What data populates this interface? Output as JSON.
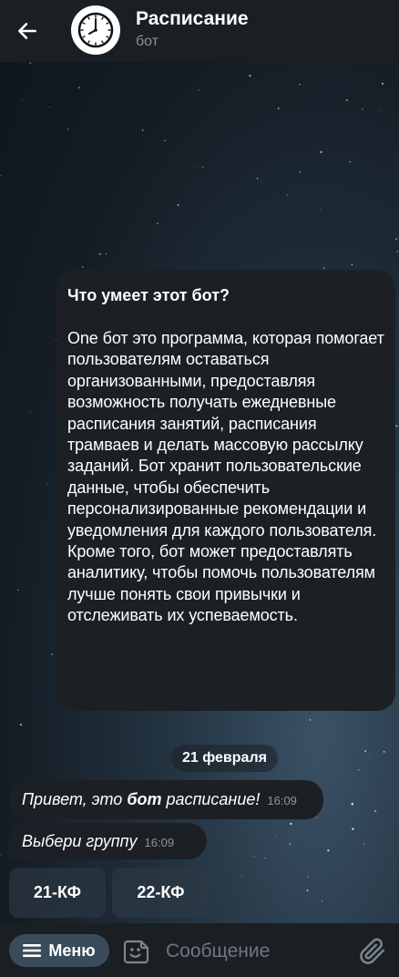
{
  "header": {
    "title": "Расписание",
    "subtitle": "бот",
    "back_icon": "arrow-left-icon",
    "avatar_icon": "clock-icon"
  },
  "intro": {
    "title": "Что умеет этот бот?",
    "text": "One бот это программа, которая помогает пользователям оставаться организованными, предоставляя возможность получать ежедневные расписания занятий, расписания трамваев и делать массовую рассылку заданий. Бот хранит пользовательские данные, чтобы обеспечить персонализированные рекомендации и уведомления для каждого пользователя. Кроме того, бот может предоставлять аналитику, чтобы помочь пользователям лучше понять свои привычки и отслеживать их успеваемость."
  },
  "date_label": "21 февраля",
  "messages": [
    {
      "before": "Привет, это ",
      "bold": "бот",
      "after": " расписание!",
      "time": "16:09"
    },
    {
      "text": "Выбери группу",
      "time": "16:09"
    }
  ],
  "keyboard": [
    "21-КФ",
    "22-КФ"
  ],
  "input_bar": {
    "menu_label": "Меню",
    "placeholder": "Сообщение",
    "menu_icon": "hamburger-icon",
    "emoji_icon": "emoji-icon",
    "attach_icon": "paperclip-icon"
  },
  "colors": {
    "header_bg": "#1a1f24",
    "bubble_bg": "#1c2024",
    "menu_button_bg": "#3a4c5c",
    "secondary_text": "#8b949c"
  }
}
